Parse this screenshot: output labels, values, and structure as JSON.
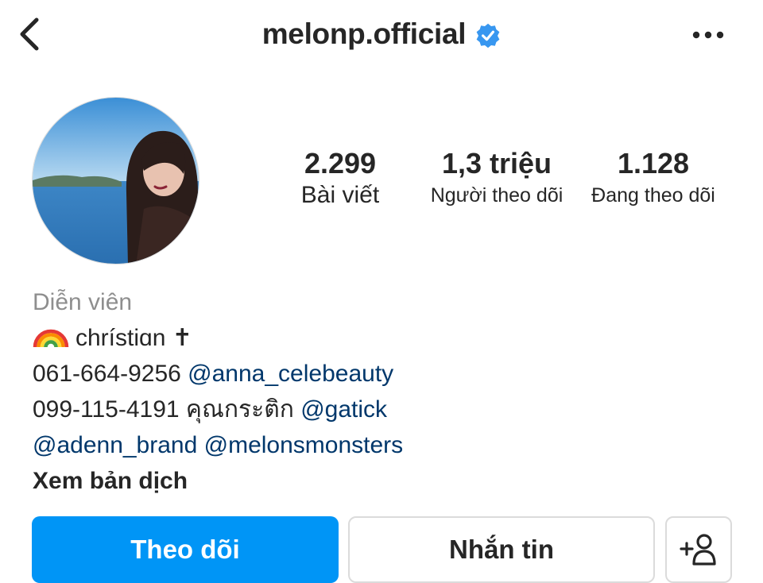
{
  "header": {
    "username": "melonp.official",
    "verified": true,
    "back_icon": "chevron-left-icon",
    "more_icon": "more-horizontal-icon"
  },
  "profile": {
    "avatar": "profile-photo",
    "stats": {
      "posts_count": "2.299",
      "posts_label": "Bài viết",
      "followers_count": "1,3 triệu",
      "followers_label": "Người theo dõi",
      "following_count": "1.128",
      "following_label": "Đang theo dõi"
    }
  },
  "bio": {
    "category": "Diễn viên",
    "line1_text": "chrístiɑn ✝",
    "line2_phone": "061-664-9256",
    "line2_mention": "@anna_celebeauty",
    "line3_text": "099-115-4191 คุณกระติก",
    "line3_mention": "@gatick",
    "line4_mention1": "@adenn_brand",
    "line4_mention2": "@melonsmonsters",
    "translate": "Xem bản dịch"
  },
  "actions": {
    "follow_label": "Theo dõi",
    "message_label": "Nhắn tin",
    "suggest_icon": "add-person-icon"
  },
  "colors": {
    "primary_blue": "#0095f6",
    "mention_blue": "#00376b",
    "verified_blue": "#3897f0",
    "text": "#262626",
    "secondary_text": "#8e8e8e",
    "border": "#dbdbdb"
  }
}
